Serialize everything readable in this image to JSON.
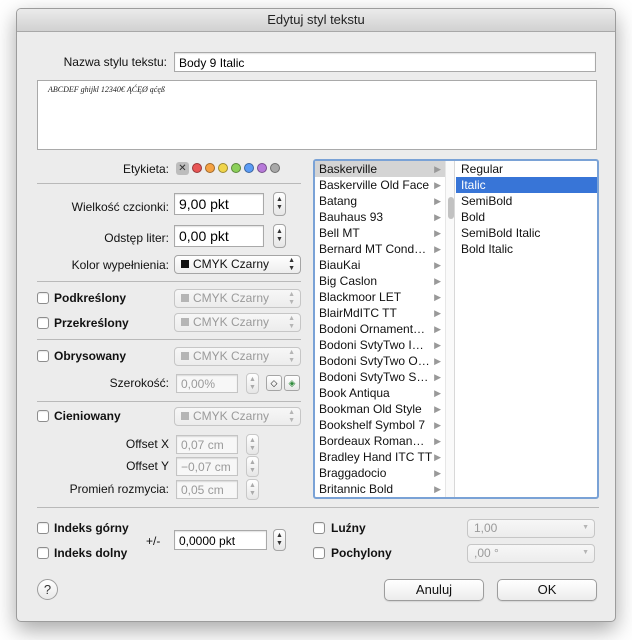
{
  "window": {
    "title": "Edytuj styl tekstu"
  },
  "style_name": {
    "label": "Nazwa stylu tekstu:",
    "value": "Body 9 Italic"
  },
  "preview": {
    "text": "ABCDEF ghijkl 12340€ ĄĆĘØ ąćęß"
  },
  "label_row": {
    "label": "Etykieta:",
    "clear_symbol": "✕",
    "colors": [
      "#e85555",
      "#f5a243",
      "#f0d54a",
      "#8cd05a",
      "#5b9cf5",
      "#b77ad9",
      "#a8a8a8"
    ]
  },
  "font_size": {
    "label": "Wielkość czcionki:",
    "value": "9,00 pkt"
  },
  "letter_spacing": {
    "label": "Odstęp liter:",
    "value": "0,00 pkt"
  },
  "fill_color": {
    "label": "Kolor wypełnienia:",
    "value": "CMYK Czarny"
  },
  "underline": {
    "label": "Podkreślony",
    "color": "CMYK Czarny"
  },
  "strikethrough": {
    "label": "Przekreślony",
    "color": "CMYK Czarny"
  },
  "outline": {
    "label": "Obrysowany",
    "color": "CMYK Czarny",
    "width_label": "Szerokość:",
    "width_value": "0,00%"
  },
  "shadow": {
    "label": "Cieniowany",
    "color": "CMYK Czarny",
    "offset_x_label": "Offset X",
    "offset_x_value": "0,07 cm",
    "offset_y_label": "Offset Y",
    "offset_y_value": "−0,07 cm",
    "blur_label": "Promień rozmycia:",
    "blur_value": "0,05 cm"
  },
  "fonts": {
    "families": [
      "Baskerville",
      "Baskerville Old Face",
      "Batang",
      "Bauhaus 93",
      "Bell MT",
      "Bernard MT Cond…",
      "BiauKai",
      "Big Caslon",
      "Blackmoor LET",
      "BlairMdITC TT",
      "Bodoni Ornament…",
      "Bodoni SvtyTwo I…",
      "Bodoni SvtyTwo O…",
      "Bodoni SvtyTwo S…",
      "Book Antiqua",
      "Bookman Old Style",
      "Bookshelf Symbol 7",
      "Bordeaux Roman…",
      "Bradley Hand ITC TT",
      "Braggadocio",
      "Britannic Bold"
    ],
    "selected_family": "Baskerville",
    "styles": [
      "Regular",
      "Italic",
      "SemiBold",
      "Bold",
      "SemiBold Italic",
      "Bold Italic"
    ],
    "selected_style": "Italic"
  },
  "superscript": {
    "label": "Indeks górny"
  },
  "subscript": {
    "label": "Indeks dolny"
  },
  "baseline": {
    "label": "+/-",
    "value": "0,0000 pkt"
  },
  "loose": {
    "label": "Luźny",
    "value": "1,00"
  },
  "oblique": {
    "label": "Pochylony",
    "value": ",00 °"
  },
  "buttons": {
    "help": "?",
    "cancel": "Anuluj",
    "ok": "OK"
  }
}
